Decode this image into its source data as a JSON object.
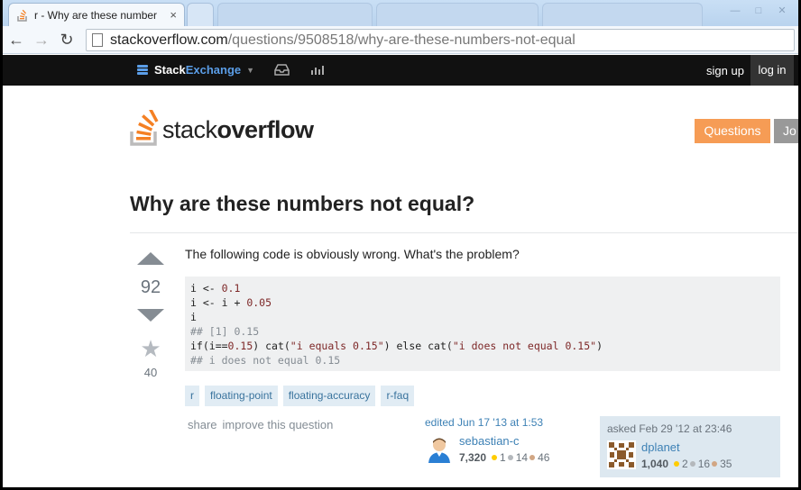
{
  "browser": {
    "tab_title": "r - Why are these number",
    "close_glyph": "×",
    "url_host": "stackoverflow.com",
    "url_path": "/questions/9508518/why-are-these-numbers-not-equal"
  },
  "se_bar": {
    "brand_stack": "Stack",
    "brand_exchange": "Exchange",
    "signup": "sign up",
    "login": "log in"
  },
  "header": {
    "logo_stack": "stack",
    "logo_overflow": "overflow",
    "questions": "Questions",
    "jobs": "Jo"
  },
  "question": {
    "title": "Why are these numbers not equal?",
    "votes": "92",
    "favorites": "40",
    "body": "The following code is obviously wrong. What's the problem?",
    "code": [
      [
        {
          "t": "i <- ",
          "c": ""
        },
        {
          "t": "0.1",
          "c": "num"
        }
      ],
      [
        {
          "t": "i <- i + ",
          "c": ""
        },
        {
          "t": "0.05",
          "c": "num"
        }
      ],
      [
        {
          "t": "i",
          "c": ""
        }
      ],
      [
        {
          "t": "## [1] 0.15",
          "c": "com"
        }
      ],
      [
        {
          "t": "if(i==",
          "c": ""
        },
        {
          "t": "0.15",
          "c": "num"
        },
        {
          "t": ") cat(",
          "c": ""
        },
        {
          "t": "\"i equals 0.15\"",
          "c": "str"
        },
        {
          "t": ") else cat(",
          "c": ""
        },
        {
          "t": "\"i does not equal 0.15\"",
          "c": "str"
        },
        {
          "t": ")",
          "c": ""
        }
      ],
      [
        {
          "t": "## i does not equal 0.15",
          "c": "com"
        }
      ]
    ],
    "tags": [
      "r",
      "floating-point",
      "floating-accuracy",
      "r-faq"
    ],
    "menu": [
      "share",
      "improve this question"
    ]
  },
  "edited": {
    "action": "edited Jun 17 '13 at 1:53",
    "user": "sebastian-c",
    "rep": "7,320",
    "gold": "1",
    "silver": "14",
    "bronze": "46"
  },
  "asked": {
    "action": "asked Feb 29 '12 at 23:46",
    "user": "dplanet",
    "rep": "1,040",
    "gold": "2",
    "silver": "16",
    "bronze": "35"
  },
  "colors": {
    "accent_orange": "#f69c55",
    "link_blue": "#3d81b5",
    "tag_bg": "#e1ecf4"
  }
}
